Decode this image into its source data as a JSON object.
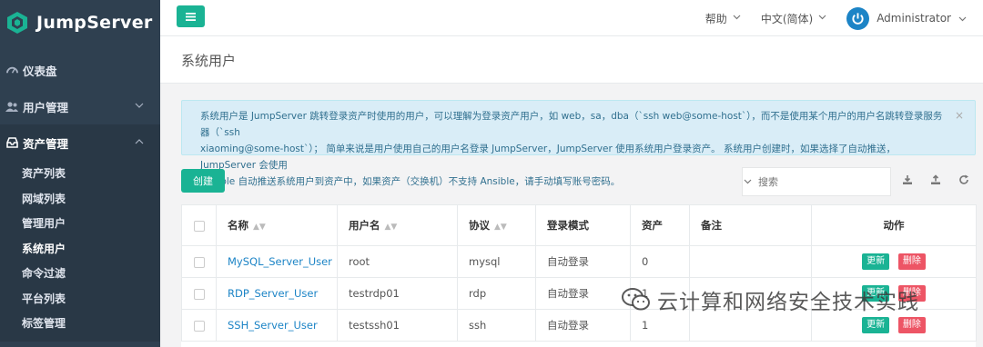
{
  "brand": {
    "name": "JumpServer"
  },
  "sidebar": {
    "items": [
      {
        "label": "仪表盘",
        "icon": "dashboard-icon"
      },
      {
        "label": "用户管理",
        "icon": "users-icon"
      },
      {
        "label": "资产管理",
        "icon": "inbox-icon"
      }
    ],
    "assets_submenu": [
      "资产列表",
      "网域列表",
      "管理用户",
      "系统用户",
      "命令过滤",
      "平台列表",
      "标签管理"
    ]
  },
  "topbar": {
    "help": "帮助",
    "language": "中文(简体)",
    "user": "Administrator"
  },
  "page": {
    "title": "系统用户"
  },
  "alert": {
    "line1": "系统用户是 JumpServer 跳转登录资产时使用的用户，可以理解为登录资产用户，如 web，sa，dba（`ssh web@some-host`），而不是使用某个用户的用户名跳转登录服务器（`ssh",
    "line2": "xiaoming@some-host`）；  简单来说是用户使用自己的用户名登录 JumpServer，JumpServer 使用系统用户登录资产。 系统用户创建时，如果选择了自动推送，JumpServer 会使用",
    "line3": "Ansible 自动推送系统用户到资产中，如果资产（交换机）不支持 Ansible，请手动填写账号密码。",
    "close": "×"
  },
  "toolbar": {
    "create": "创建",
    "search_placeholder": "搜索"
  },
  "table": {
    "headers": {
      "name": "名称",
      "username": "用户名",
      "protocol": "协议",
      "login_mode": "登录模式",
      "assets": "资产",
      "comment": "备注",
      "actions": "动作"
    },
    "rows": [
      {
        "name": "MySQL_Server_User",
        "username": "root",
        "protocol": "mysql",
        "login_mode": "自动登录",
        "assets": "0",
        "comment": "",
        "update": "更新",
        "delete": "删除"
      },
      {
        "name": "RDP_Server_User",
        "username": "testrdp01",
        "protocol": "rdp",
        "login_mode": "自动登录",
        "assets": "1",
        "comment": "",
        "update": "更新",
        "delete": "删除"
      },
      {
        "name": "SSH_Server_User",
        "username": "testssh01",
        "protocol": "ssh",
        "login_mode": "自动登录",
        "assets": "1",
        "comment": "",
        "update": "更新",
        "delete": "删除"
      }
    ]
  },
  "watermark": {
    "text": "云计算和网络安全技术实践"
  },
  "colors": {
    "sidebar": "#2f4050",
    "primary": "#1ab394",
    "danger": "#ed5565",
    "link": "#1c84c6",
    "alert_bg": "#d9edf7"
  }
}
